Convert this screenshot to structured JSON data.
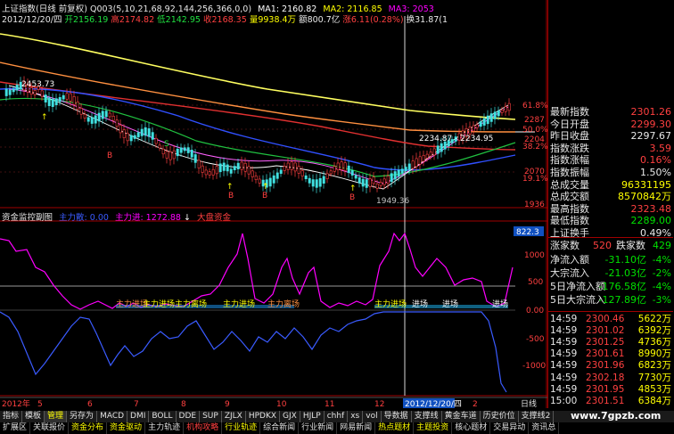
{
  "header": {
    "line1": [
      {
        "text": "上证指数(日线 前复权)",
        "color": "#e8e8e8"
      },
      {
        "text": "Q003(5,10,21,68,92,144,256,366,0,0)",
        "color": "#e8e8e8"
      },
      {
        "text": "MA1: 2160.82",
        "color": "#ffffff"
      },
      {
        "text": "MA2: 2116.85",
        "color": "#ffff00"
      },
      {
        "text": "MA3: 2053",
        "color": "#ff00ff"
      }
    ],
    "line2": [
      {
        "text": "2012/12/20/四",
        "color": "#e8e8e8"
      },
      {
        "text": "开2156.19",
        "color": "#ff4040"
      },
      {
        "text": "高2174.82",
        "color": "#ff4040"
      },
      {
        "text": "低2142.95",
        "color": "#ff4040"
      },
      {
        "text": "收2168.35",
        "color": "#ff4040"
      },
      {
        "text": "量9938.4万",
        "color": "#ffff00"
      },
      {
        "text": "额800.7亿",
        "color": "#e8e8e8"
      },
      {
        "text": "涨6.11(0.28%)",
        "color": "#ff4040"
      },
      {
        "text": "换31.87(1",
        "color": "#e8e8e8"
      }
    ]
  },
  "main_chart": {
    "price_labels": [
      {
        "text": "61.8%",
        "color": "#ff4040"
      },
      {
        "text": "2287",
        "color": "#ff4040"
      },
      {
        "text": "50.0%",
        "color": "#ff4040"
      },
      {
        "text": "2204",
        "color": "#ff4040"
      },
      {
        "text": "38.2%",
        "color": "#ff4040"
      },
      {
        "text": "2070",
        "color": "#ff4040"
      },
      {
        "text": "19.1%",
        "color": "#ff4040"
      },
      {
        "text": "1936",
        "color": "#ff4040"
      }
    ],
    "annotations": {
      "high": "2453.73",
      "range": "2234.87 - 2234.95",
      "low": "1949.36"
    }
  },
  "indicator_header": [
    {
      "text": "资金监控副图",
      "color": "#e8e8e8"
    },
    {
      "text": "主力散: 0.00",
      "color": "#3a5bff"
    },
    {
      "text": "主力进: 1272.88",
      "color": "#ff00ff"
    },
    {
      "text": "大盘资金",
      "color": "#ff4040"
    }
  ],
  "indicator_labels": [
    {
      "text": "822.3",
      "color": "#ffffff"
    },
    {
      "text": "1000",
      "color": "#ff4040"
    },
    {
      "text": "500",
      "color": "#ff4040"
    },
    {
      "text": "0.00",
      "color": "#ff4040"
    },
    {
      "text": "-500",
      "color": "#ff4040"
    },
    {
      "text": "-1000",
      "color": "#ff4040"
    }
  ],
  "signal_texts": [
    "主力进场",
    "主力进场",
    "主力离场",
    "主力进场",
    "主力离场",
    "主力进场",
    "进场",
    "进场",
    "进场"
  ],
  "date_axis": [
    "2012年",
    "5",
    "6",
    "7",
    "8",
    "9",
    "10",
    "11",
    "12",
    "2012/12/20/四",
    "2",
    "日线"
  ],
  "stats": [
    {
      "label": "最新指数",
      "value": "2301.26",
      "color": "#ff4040"
    },
    {
      "label": "今日开盘",
      "value": "2299.30",
      "color": "#ff4040"
    },
    {
      "label": "昨日收盘",
      "value": "2297.67",
      "color": "#e8e8e8"
    },
    {
      "label": "指数涨跌",
      "value": "3.59",
      "color": "#ff4040"
    },
    {
      "label": "指数涨幅",
      "value": "0.16%",
      "color": "#ff4040"
    },
    {
      "label": "指数振幅",
      "value": "1.50%",
      "color": "#e8e8e8"
    },
    {
      "label": "总成交量",
      "value": "96331195",
      "color": "#ffff00"
    },
    {
      "label": "总成交额",
      "value": "8570842万",
      "color": "#ffff00"
    },
    {
      "label": "最高指数",
      "value": "2323.48",
      "color": "#ff4040"
    },
    {
      "label": "最低指数",
      "value": "2289.00",
      "color": "#00e000"
    },
    {
      "label": "上证换手",
      "value": "0.49%",
      "color": "#e8e8e8"
    }
  ],
  "updown": {
    "up_label": "涨家数",
    "up_value": "520",
    "down_label": "跌家数",
    "down_value": "429"
  },
  "flows": [
    {
      "label": "净流入额",
      "value": "-31.10亿",
      "pct": "-4%"
    },
    {
      "label": "大宗流入",
      "value": "-21.03亿",
      "pct": "-2%"
    },
    {
      "label": "5日净流入额",
      "value": "-176.58亿",
      "pct": "-4%"
    },
    {
      "label": "5日大宗流入",
      "value": "-127.89亿",
      "pct": "-3%"
    }
  ],
  "trades": [
    {
      "time": "14:59",
      "price": "2300.46",
      "vol": "5622万",
      "pcolor": "#ff4040"
    },
    {
      "time": "14:59",
      "price": "2301.02",
      "vol": "6392万",
      "pcolor": "#ff4040"
    },
    {
      "time": "14:59",
      "price": "2301.25",
      "vol": "4736万",
      "pcolor": "#ff4040"
    },
    {
      "time": "14:59",
      "price": "2301.61",
      "vol": "8990万",
      "pcolor": "#ff4040"
    },
    {
      "time": "14:59",
      "price": "2301.96",
      "vol": "6823万",
      "pcolor": "#ff4040"
    },
    {
      "time": "14:59",
      "price": "2302.18",
      "vol": "7730万",
      "pcolor": "#ff4040"
    },
    {
      "time": "14:59",
      "price": "2301.95",
      "vol": "4853万",
      "pcolor": "#ff4040"
    },
    {
      "time": "15:00",
      "price": "2301.51",
      "vol": "6384万",
      "pcolor": "#ff4040"
    }
  ],
  "tabs1": [
    {
      "label": "指标",
      "active": false
    },
    {
      "label": "模板",
      "active": false
    },
    {
      "label": "管理",
      "active": true
    },
    {
      "label": "另存为",
      "active": false
    },
    {
      "label": "MACD",
      "active": false
    },
    {
      "label": "DMI",
      "active": false
    },
    {
      "label": "BOLL",
      "active": false
    },
    {
      "label": "DDE",
      "active": false
    },
    {
      "label": "SUP",
      "active": false
    },
    {
      "label": "ZJLX",
      "active": false
    },
    {
      "label": "HPDKX",
      "active": false
    },
    {
      "label": "GJX",
      "active": false
    },
    {
      "label": "HJLP",
      "active": false
    },
    {
      "label": "chhf",
      "active": false
    },
    {
      "label": "xs",
      "active": false
    },
    {
      "label": "vol",
      "active": false
    },
    {
      "label": "导数据",
      "active": false
    },
    {
      "label": "支撑线",
      "active": false
    },
    {
      "label": "黄金车道",
      "active": false
    },
    {
      "label": "历史价位",
      "active": false
    },
    {
      "label": "支撑线2",
      "active": false
    }
  ],
  "tabs2": [
    {
      "label": "扩展区",
      "color": "#e0e0e0"
    },
    {
      "label": "关联报价",
      "color": "#e0e0e0"
    },
    {
      "label": "资金分布",
      "color": "#ffff00"
    },
    {
      "label": "资金驱动",
      "color": "#ffff00"
    },
    {
      "label": "主力轨迹",
      "color": "#e0e0e0"
    },
    {
      "label": "机构攻略",
      "color": "#ff4040"
    },
    {
      "label": "行业轨迹",
      "color": "#ffff00"
    },
    {
      "label": "综合新闻",
      "color": "#e0e0e0"
    },
    {
      "label": "行业新闻",
      "color": "#e0e0e0"
    },
    {
      "label": "网易新闻",
      "color": "#e0e0e0"
    },
    {
      "label": "热点题材",
      "color": "#ffff00"
    },
    {
      "label": "主题投资",
      "color": "#ffff00"
    },
    {
      "label": "核心题材",
      "color": "#e0e0e0"
    },
    {
      "label": "交易异动",
      "color": "#e0e0e0"
    },
    {
      "label": "资讯总",
      "color": "#e0e0e0"
    }
  ],
  "watermark": "www.7gpzb.com"
}
